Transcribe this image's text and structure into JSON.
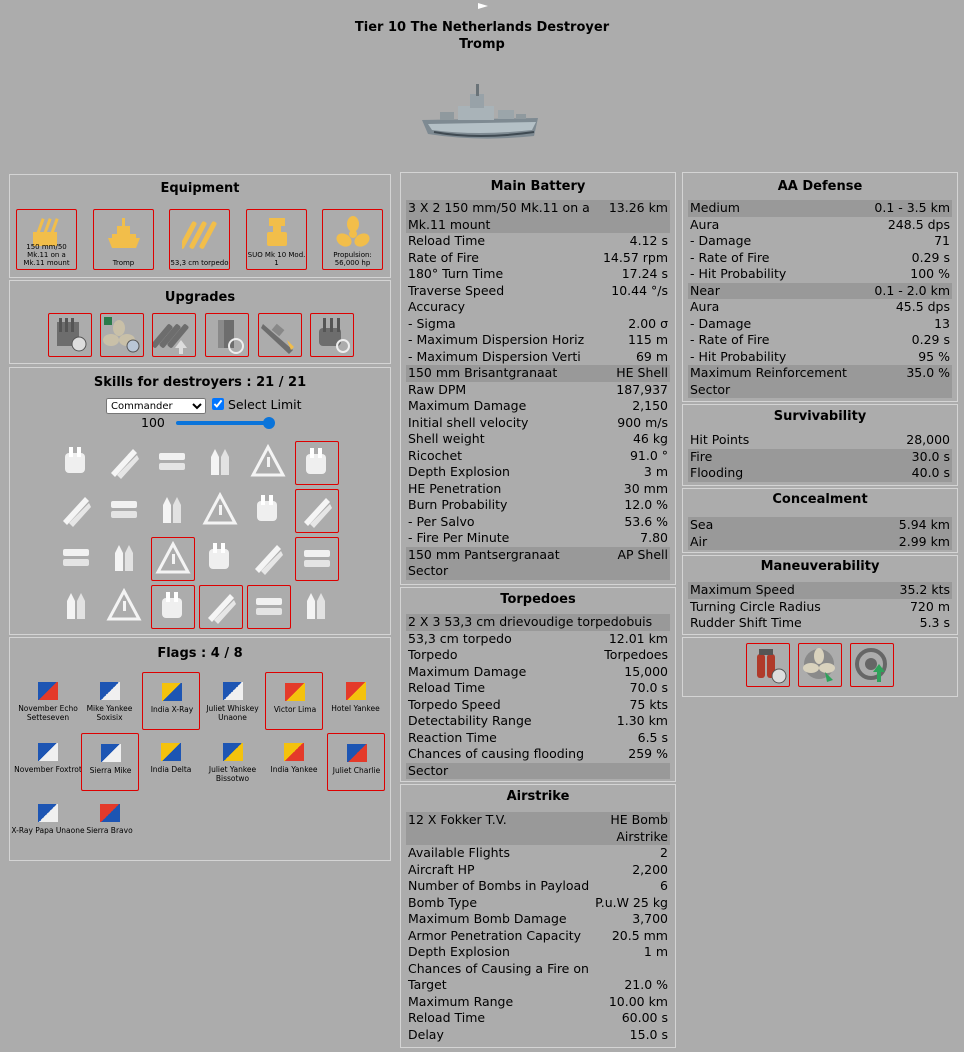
{
  "header": {
    "title": "Tier 10 The Netherlands Destroyer",
    "ship_name": "Tromp"
  },
  "equipment": {
    "title": "Equipment",
    "items": [
      {
        "label": "150 mm/50 Mk.11 on a Mk.11 mount",
        "icon": "gun-turret-icon"
      },
      {
        "label": "Tromp",
        "icon": "hull-icon"
      },
      {
        "label": "53,3 cm torpedo",
        "icon": "torpedo-icon"
      },
      {
        "label": "SUO Mk 10 Mod. 1",
        "icon": "fire-control-icon"
      },
      {
        "label": "Propulsion: 56,000 hp",
        "icon": "propeller-icon"
      }
    ]
  },
  "upgrades": {
    "title": "Upgrades"
  },
  "skills": {
    "title": "Skills for destroyers : 21 / 21",
    "commander": "Commander",
    "select_limit": "Select Limit",
    "level": "100"
  },
  "flags": {
    "title": "Flags : 4 / 8",
    "items": [
      {
        "label": "November Echo Setteseven",
        "selected": false
      },
      {
        "label": "Mike Yankee Soxisix",
        "selected": false
      },
      {
        "label": "India X-Ray",
        "selected": true
      },
      {
        "label": "Juliet Whiskey Unaone",
        "selected": false
      },
      {
        "label": "Victor Lima",
        "selected": true
      },
      {
        "label": "Hotel Yankee",
        "selected": false
      },
      {
        "label": "November Foxtrot",
        "selected": false
      },
      {
        "label": "Sierra Mike",
        "selected": true
      },
      {
        "label": "India Delta",
        "selected": false
      },
      {
        "label": "Juliet Yankee Bissotwo",
        "selected": false
      },
      {
        "label": "India Yankee",
        "selected": false
      },
      {
        "label": "Juliet Charlie",
        "selected": true
      },
      {
        "label": "X-Ray Papa Unaone",
        "selected": false
      },
      {
        "label": "Sierra Bravo",
        "selected": false
      }
    ]
  },
  "main_battery": {
    "title": "Main Battery",
    "rows": [
      {
        "k": "3 X 2 150 mm/50 Mk.11 on a Mk.11 mount",
        "v": "13.26 km",
        "g": true,
        "tall": true
      },
      {
        "k": "Reload Time",
        "v": "4.12 s"
      },
      {
        "k": "Rate of Fire",
        "v": "14.57 rpm"
      },
      {
        "k": "180° Turn Time",
        "v": "17.24 s"
      },
      {
        "k": "Traverse Speed",
        "v": "10.44 °/s"
      },
      {
        "k": "Accuracy",
        "v": ""
      },
      {
        "k": "- Sigma",
        "v": "2.00 σ"
      },
      {
        "k": "- Maximum Dispersion Horiz",
        "v": "115 m"
      },
      {
        "k": "- Maximum Dispersion Verti",
        "v": "69 m"
      },
      {
        "k": "150 mm Brisantgranaat",
        "v": "HE Shell",
        "g": true
      },
      {
        "k": "Raw DPM",
        "v": "187,937"
      },
      {
        "k": "Maximum Damage",
        "v": "2,150"
      },
      {
        "k": "Initial shell velocity",
        "v": "900 m/s"
      },
      {
        "k": "Shell weight",
        "v": "46 kg"
      },
      {
        "k": "Ricochet",
        "v": "91.0 °"
      },
      {
        "k": "Depth Explosion",
        "v": "3 m"
      },
      {
        "k": "HE Penetration",
        "v": "30 mm"
      },
      {
        "k": "Burn Probability",
        "v": "12.0 %"
      },
      {
        "k": "- Per Salvo",
        "v": "53.6 %"
      },
      {
        "k": "- Fire Per Minute",
        "v": "7.80"
      },
      {
        "k": "150 mm Pantsergranaat",
        "v": "AP Shell",
        "g": true
      },
      {
        "k": "Sector",
        "v": "",
        "g": true
      }
    ]
  },
  "torpedoes": {
    "title": "Torpedoes",
    "rows": [
      {
        "k": "2 X 3 53,3 cm drievoudige torpedobuis",
        "v": "",
        "g": true
      },
      {
        "k": "53,3 cm torpedo",
        "v": "12.01 km"
      },
      {
        "k": "Torpedo",
        "v": "Torpedoes"
      },
      {
        "k": "Maximum Damage",
        "v": "15,000"
      },
      {
        "k": "Reload Time",
        "v": "70.0 s"
      },
      {
        "k": "Torpedo Speed",
        "v": "75 kts"
      },
      {
        "k": "Detectability Range",
        "v": "1.30 km"
      },
      {
        "k": "Reaction Time",
        "v": "6.5 s"
      },
      {
        "k": "Chances of causing flooding",
        "v": "259 %"
      },
      {
        "k": "Sector",
        "v": "",
        "g": true
      }
    ]
  },
  "airstrike": {
    "title": "Airstrike",
    "rows": [
      {
        "k": "12 X Fokker T.V.",
        "v": "HE Bomb Airstrike",
        "g": true,
        "tall": true
      },
      {
        "k": "Available Flights",
        "v": "2"
      },
      {
        "k": "Aircraft HP",
        "v": "2,200"
      },
      {
        "k": "Number of Bombs in Payload",
        "v": "6"
      },
      {
        "k": "Bomb Type",
        "v": "P.u.W 25 kg"
      },
      {
        "k": "Maximum Bomb Damage",
        "v": "3,700"
      },
      {
        "k": "Armor Penetration Capacity",
        "v": "20.5 mm"
      },
      {
        "k": "Depth Explosion",
        "v": "1 m"
      },
      {
        "k": "Chances of Causing a Fire on Target",
        "v": "21.0 %",
        "tall": true
      },
      {
        "k": "Maximum Range",
        "v": "10.00 km"
      },
      {
        "k": "Reload Time",
        "v": "60.00 s"
      },
      {
        "k": "Delay",
        "v": "15.0 s"
      }
    ]
  },
  "aa_defense": {
    "title": "AA Defense",
    "rows": [
      {
        "k": "Medium",
        "v": "0.1 - 3.5 km",
        "g": true
      },
      {
        "k": "Aura",
        "v": "248.5 dps"
      },
      {
        "k": "- Damage",
        "v": "71"
      },
      {
        "k": "- Rate of Fire",
        "v": "0.29 s"
      },
      {
        "k": "- Hit Probability",
        "v": "100 %"
      },
      {
        "k": "Near",
        "v": "0.1 - 2.0 km",
        "g": true
      },
      {
        "k": "Aura",
        "v": "45.5 dps"
      },
      {
        "k": "- Damage",
        "v": "13"
      },
      {
        "k": "- Rate of Fire",
        "v": "0.29 s"
      },
      {
        "k": "- Hit Probability",
        "v": "95 %"
      },
      {
        "k": "Maximum Reinforcement",
        "v": "35.0 %",
        "g": true
      },
      {
        "k": "Sector",
        "v": "",
        "g": true
      }
    ]
  },
  "survivability": {
    "title": "Survivability",
    "rows": [
      {
        "k": "Hit Points",
        "v": "28,000"
      },
      {
        "k": "Fire",
        "v": "30.0 s",
        "g": true
      },
      {
        "k": "Flooding",
        "v": "40.0 s",
        "g": true
      }
    ]
  },
  "concealment": {
    "title": "Concealment",
    "rows": [
      {
        "k": "Sea",
        "v": "5.94 km",
        "g": true
      },
      {
        "k": "Air",
        "v": "2.99 km",
        "g": true
      }
    ]
  },
  "maneuverability": {
    "title": "Maneuverability",
    "rows": [
      {
        "k": "Maximum Speed",
        "v": "35.2 kts",
        "g": true
      },
      {
        "k": "Turning Circle Radius",
        "v": "720 m"
      },
      {
        "k": "Rudder Shift Time",
        "v": "5.3 s"
      }
    ]
  }
}
